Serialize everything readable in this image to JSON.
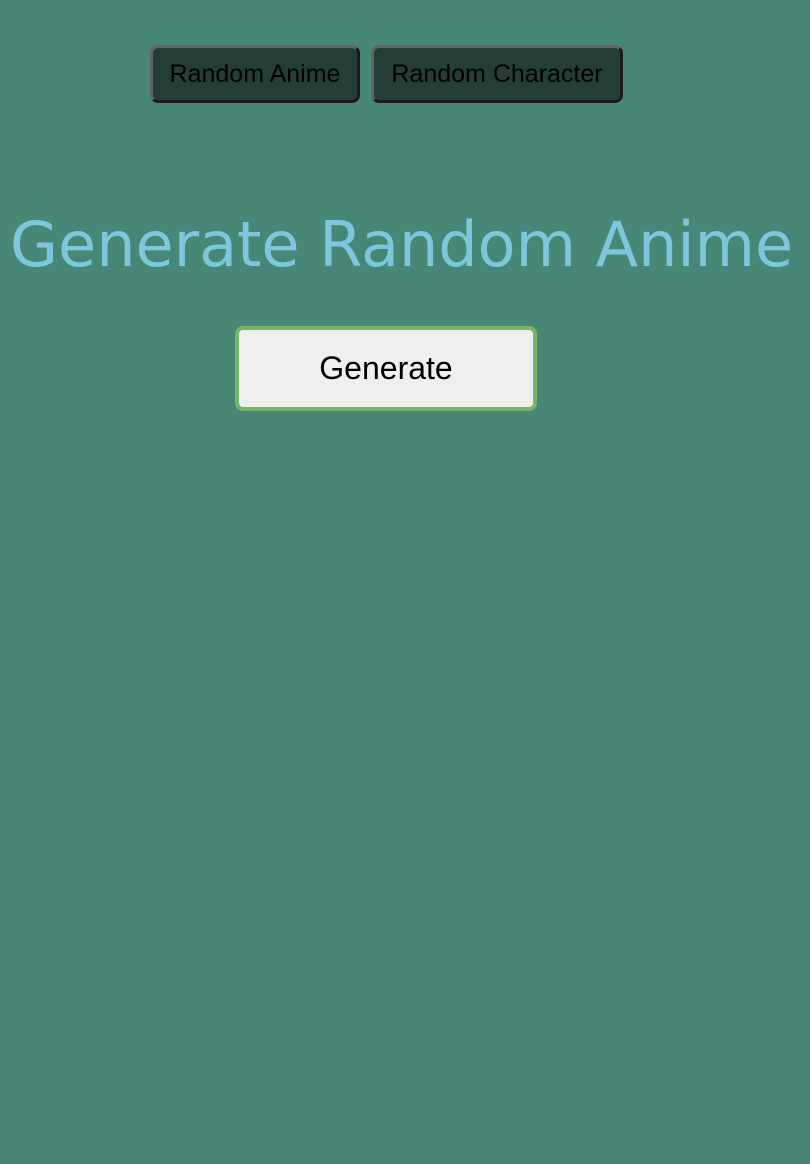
{
  "nav": {
    "random_anime_label": "Random Anime",
    "random_character_label": "Random Character"
  },
  "main": {
    "title": "Generate Random Anime",
    "generate_label": "Generate"
  },
  "colors": {
    "background": "#488775",
    "nav_button_bg": "#243e37",
    "title_text": "#7ec6db",
    "generate_border": "#76b664",
    "generate_bg": "#efefef"
  }
}
